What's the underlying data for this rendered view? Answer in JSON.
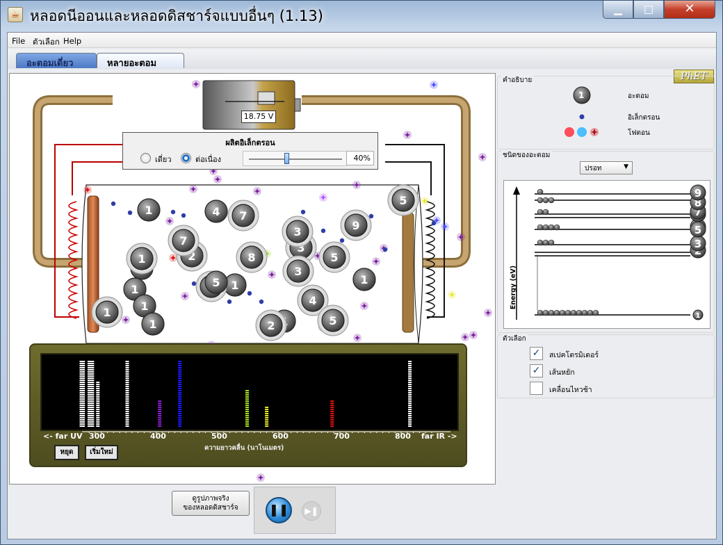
{
  "window": {
    "title": "หลอดนีออนและหลอดดิสชาร์จแบบอื่นๆ (1.13)",
    "minimize": "▁",
    "maximize": "□",
    "close": "✕"
  },
  "menu": [
    "File",
    "ตัวเลือก",
    "Help"
  ],
  "tabs": [
    {
      "label": "อะตอมเดี่ยว"
    },
    {
      "label": "หลายอะตอม"
    }
  ],
  "logo": "PhET",
  "battery": {
    "voltage": "18.75 V"
  },
  "electron_gun": {
    "title": "ผลิตอิเล็กตรอน",
    "mode_single": "เดี่ยว",
    "mode_continuous": "ต่อเนื่อง",
    "selected_mode": "ต่อเนื่อง",
    "rate": "40%",
    "rate_fraction": 0.4
  },
  "atoms": [
    "1",
    "1",
    "1",
    "1",
    "1",
    "1",
    "1",
    "1",
    "1",
    "1",
    "2",
    "2",
    "3",
    "3",
    "3",
    "4",
    "4",
    "5",
    "5",
    "5",
    "5",
    "5",
    "7",
    "7",
    "8",
    "9"
  ],
  "spectrometer": {
    "far_uv": "<- far UV",
    "far_ir": "far IR ->",
    "ticks": [
      "300",
      "400",
      "500",
      "600",
      "700",
      "800"
    ],
    "axis_label": "ความยาวคลื่น (นาโนเมตร)",
    "stop_label": "หยุด",
    "reset_label": "เริ่มใหม่",
    "lines": [
      {
        "nm": 275,
        "color": "#ffffff",
        "level": 1.0
      },
      {
        "nm": 278,
        "color": "#ffffff",
        "level": 1.0
      },
      {
        "nm": 288,
        "color": "#ffffff",
        "level": 1.0
      },
      {
        "nm": 293,
        "color": "#ffffff",
        "level": 1.0
      },
      {
        "nm": 302,
        "color": "#ffffff",
        "level": 0.68
      },
      {
        "nm": 350,
        "color": "#ffffff",
        "level": 1.0
      },
      {
        "nm": 403,
        "color": "#8a1fcf",
        "level": 0.4
      },
      {
        "nm": 436,
        "color": "#1a1aff",
        "level": 0.97
      },
      {
        "nm": 546,
        "color": "#a8e21e",
        "level": 0.55
      },
      {
        "nm": 578,
        "color": "#eaea20",
        "level": 0.3
      },
      {
        "nm": 685,
        "color": "#e01010",
        "level": 0.4
      },
      {
        "nm": 812,
        "color": "#ffffff",
        "level": 1.0
      }
    ]
  },
  "controls": {
    "real_tube_button_line1": "ดูรูปภาพจริง",
    "real_tube_button_line2": "ของหลอดดิสชาร์จ",
    "pause": "❚❚",
    "step": "▶❚"
  },
  "legend": {
    "title": "คำอธิบาย",
    "atom_symbol": "1",
    "atom": "อะตอม",
    "electron": "อิเล็กตรอน",
    "photon": "โฟตอน"
  },
  "atom_type": {
    "title": "ชนิดของอะตอม",
    "selected": "ปรอท",
    "arrow": "▼",
    "energy_axis": "Energy (eV)",
    "levels": [
      "1",
      "2",
      "3",
      "4",
      "5",
      "6",
      "7",
      "8",
      "9"
    ]
  },
  "options": {
    "title": "ตัวเลือก",
    "items": [
      {
        "label": "สเปคโตรมิเตอร์",
        "checked": true
      },
      {
        "label": "เส้นหยัก",
        "checked": true
      },
      {
        "label": "เคลื่อนไหวช้า",
        "checked": false
      }
    ],
    "check_mark": "✓"
  }
}
